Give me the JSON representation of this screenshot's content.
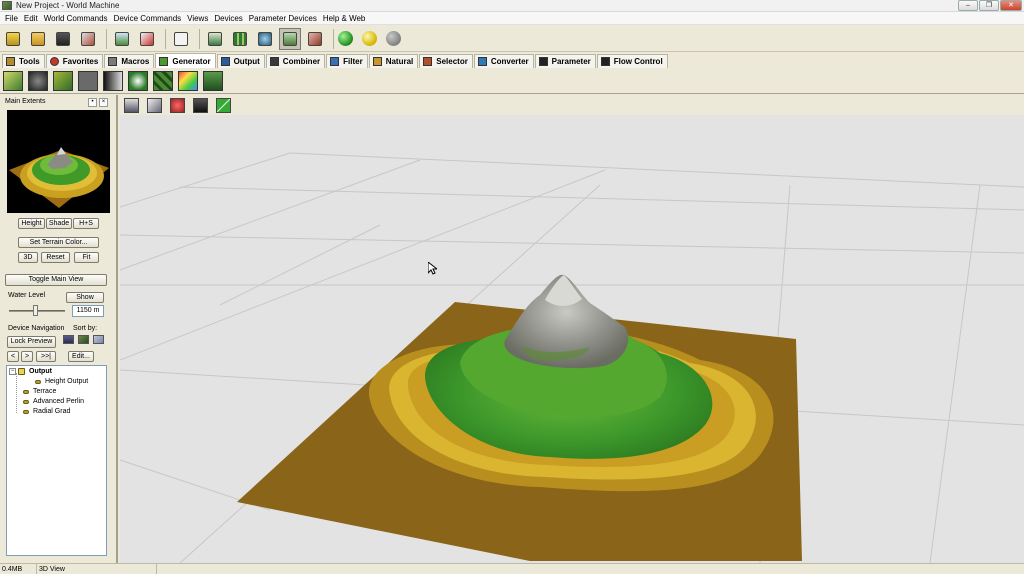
{
  "window": {
    "title": "New Project - World Machine"
  },
  "menu": [
    "File",
    "Edit",
    "World Commands",
    "Device Commands",
    "Views",
    "Devices",
    "Parameter Devices",
    "Help & Web"
  ],
  "device_tabs": [
    {
      "label": "Tools",
      "color": "#b38b2c"
    },
    {
      "label": "Favorites",
      "color": "#c0392b"
    },
    {
      "label": "Macros",
      "color": "#7a7a7a"
    },
    {
      "label": "Generator",
      "color": "#4a9a2f"
    },
    {
      "label": "Output",
      "color": "#2e5c9a"
    },
    {
      "label": "Combiner",
      "color": "#3a3a3a"
    },
    {
      "label": "Filter",
      "color": "#3b6fb5"
    },
    {
      "label": "Natural",
      "color": "#c8962c"
    },
    {
      "label": "Selector",
      "color": "#b44f2a"
    },
    {
      "label": "Converter",
      "color": "#2f7ab5"
    },
    {
      "label": "Parameter",
      "color": "#222222"
    },
    {
      "label": "Flow Control",
      "color": "#222222"
    }
  ],
  "active_tab": "Generator",
  "left_panel": {
    "header": "Main Extents",
    "view_buttons": [
      "Height",
      "Shade",
      "H+S"
    ],
    "set_terrain_color": "Set Terrain Color...",
    "preview_buttons": [
      "3D",
      "Reset",
      "Fit"
    ],
    "toggle_main_view": "Toggle Main View",
    "water_level_label": "Water Level",
    "show_button": "Show",
    "water_level_value": "1150 m",
    "device_navigation_label": "Device Navigation",
    "sort_by_label": "Sort by:",
    "lock_preview": "Lock Preview",
    "nav_buttons": [
      "<",
      ">",
      ">>|"
    ],
    "edit_button": "Edit...",
    "tree": {
      "root": "Output",
      "root_child": "Height Output",
      "items": [
        "Terrace",
        "Advanced Perlin",
        "Radial Grad"
      ]
    }
  },
  "status": {
    "memory": "0.4MB",
    "view": "3D View"
  },
  "colors": {
    "chrome": "#ece9d8",
    "viewport_bg": "#e3e3e3",
    "terrain_sand": "#c8a020",
    "terrain_green": "#3f9a28",
    "terrain_rock": "#8c8c88",
    "base_plane": "#8a6418"
  }
}
